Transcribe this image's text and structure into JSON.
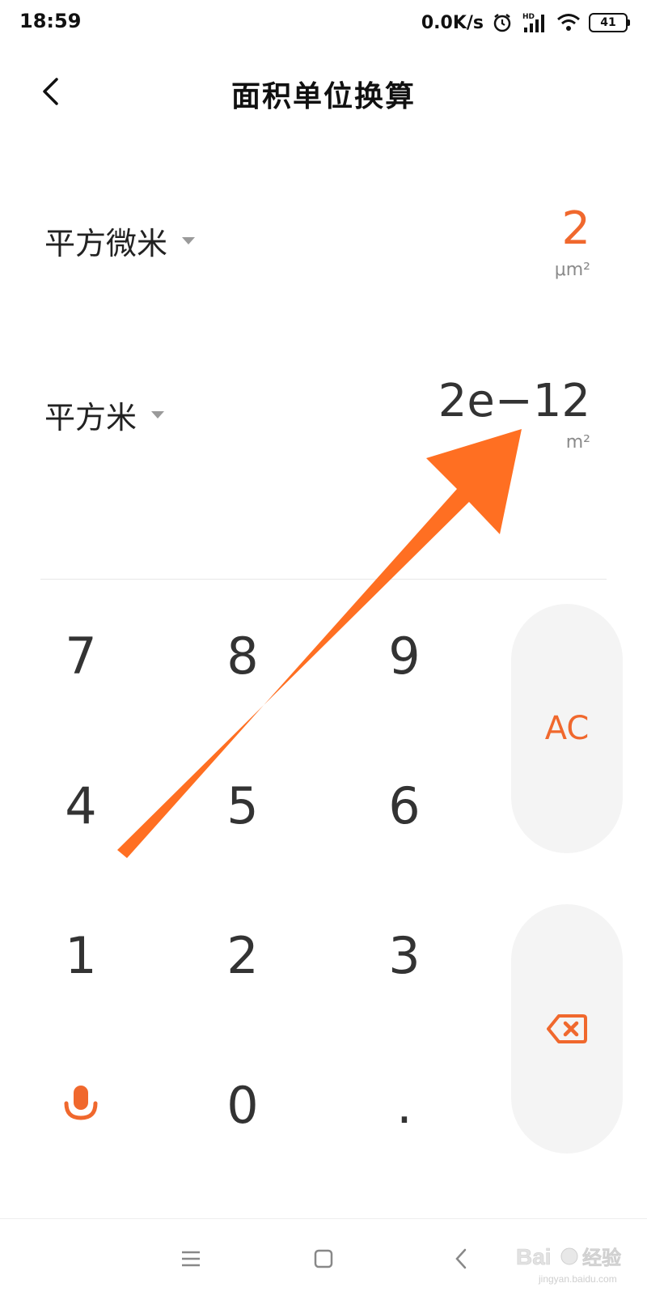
{
  "status_bar": {
    "time": "18:59",
    "net_speed": "0.0K/s",
    "hd_label": "HD",
    "battery": "41"
  },
  "header": {
    "title": "面积单位换算"
  },
  "converter": {
    "from": {
      "unit_name": "平方微米",
      "value": "2",
      "symbol": "μm²"
    },
    "to": {
      "unit_name": "平方米",
      "value": "2e−12",
      "symbol": "m²"
    }
  },
  "keypad": {
    "keys": [
      "7",
      "8",
      "9",
      "4",
      "5",
      "6",
      "1",
      "2",
      "3",
      "0",
      "."
    ],
    "ac_label": "AC",
    "voice_icon": "microphone-icon",
    "backspace_icon": "backspace-icon"
  },
  "nav": {
    "icons": [
      "menu-icon",
      "home-icon",
      "back-icon"
    ]
  },
  "watermark": {
    "text": "Bai经验",
    "url_text": "jingyan.baidu.com"
  },
  "colors": {
    "accent": "#f0682d",
    "arrow": "#ff6f22",
    "key_text": "#333333",
    "side_button_bg": "#f4f4f4"
  }
}
